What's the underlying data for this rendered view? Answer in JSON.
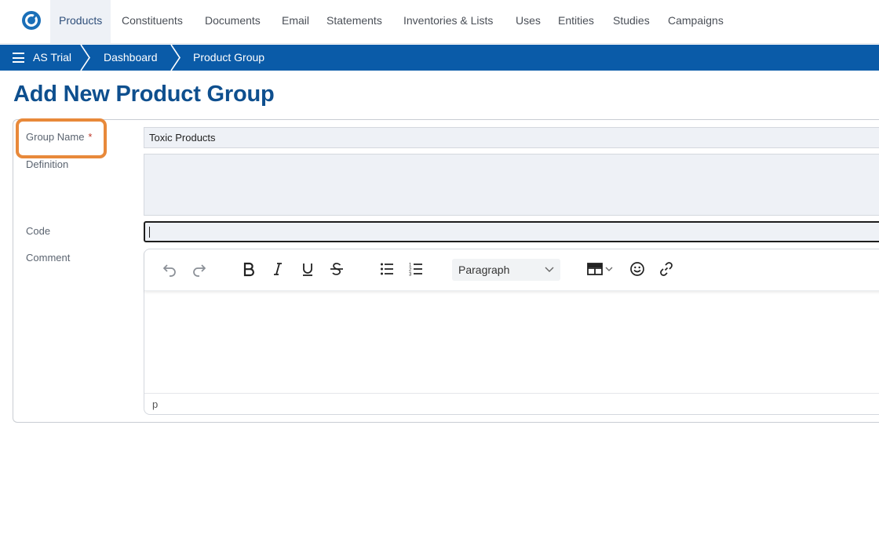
{
  "nav": {
    "items": [
      {
        "label": "Products",
        "active": true
      },
      {
        "label": "Constituents"
      },
      {
        "label": "Documents"
      },
      {
        "label": "Email"
      },
      {
        "label": "Statements"
      },
      {
        "label": "Inventories & Lists"
      },
      {
        "label": "Uses"
      },
      {
        "label": "Entities"
      },
      {
        "label": "Studies"
      },
      {
        "label": "Campaigns"
      }
    ]
  },
  "breadcrumb": {
    "items": [
      "AS Trial",
      "Dashboard",
      "Product Group"
    ]
  },
  "page": {
    "title": "Add New Product Group"
  },
  "form": {
    "group_name": {
      "label": "Group Name",
      "required_mark": "*",
      "value": "Toxic Products"
    },
    "definition": {
      "label": "Definition",
      "value": ""
    },
    "code": {
      "label": "Code",
      "value": ""
    },
    "comment": {
      "label": "Comment"
    }
  },
  "editor": {
    "block_format": "Paragraph",
    "status_path": "p",
    "tools": [
      "undo-icon",
      "redo-icon",
      "bold-icon",
      "italic-icon",
      "underline-icon",
      "strikethrough-icon",
      "bullet-list-icon",
      "numbered-list-icon",
      "table-icon",
      "emoji-icon",
      "link-icon"
    ]
  },
  "colors": {
    "brand_blue": "#0a5ba8",
    "title_blue": "#0e4f8e",
    "highlight_orange": "#e8893a",
    "required_red": "#c0392b"
  }
}
